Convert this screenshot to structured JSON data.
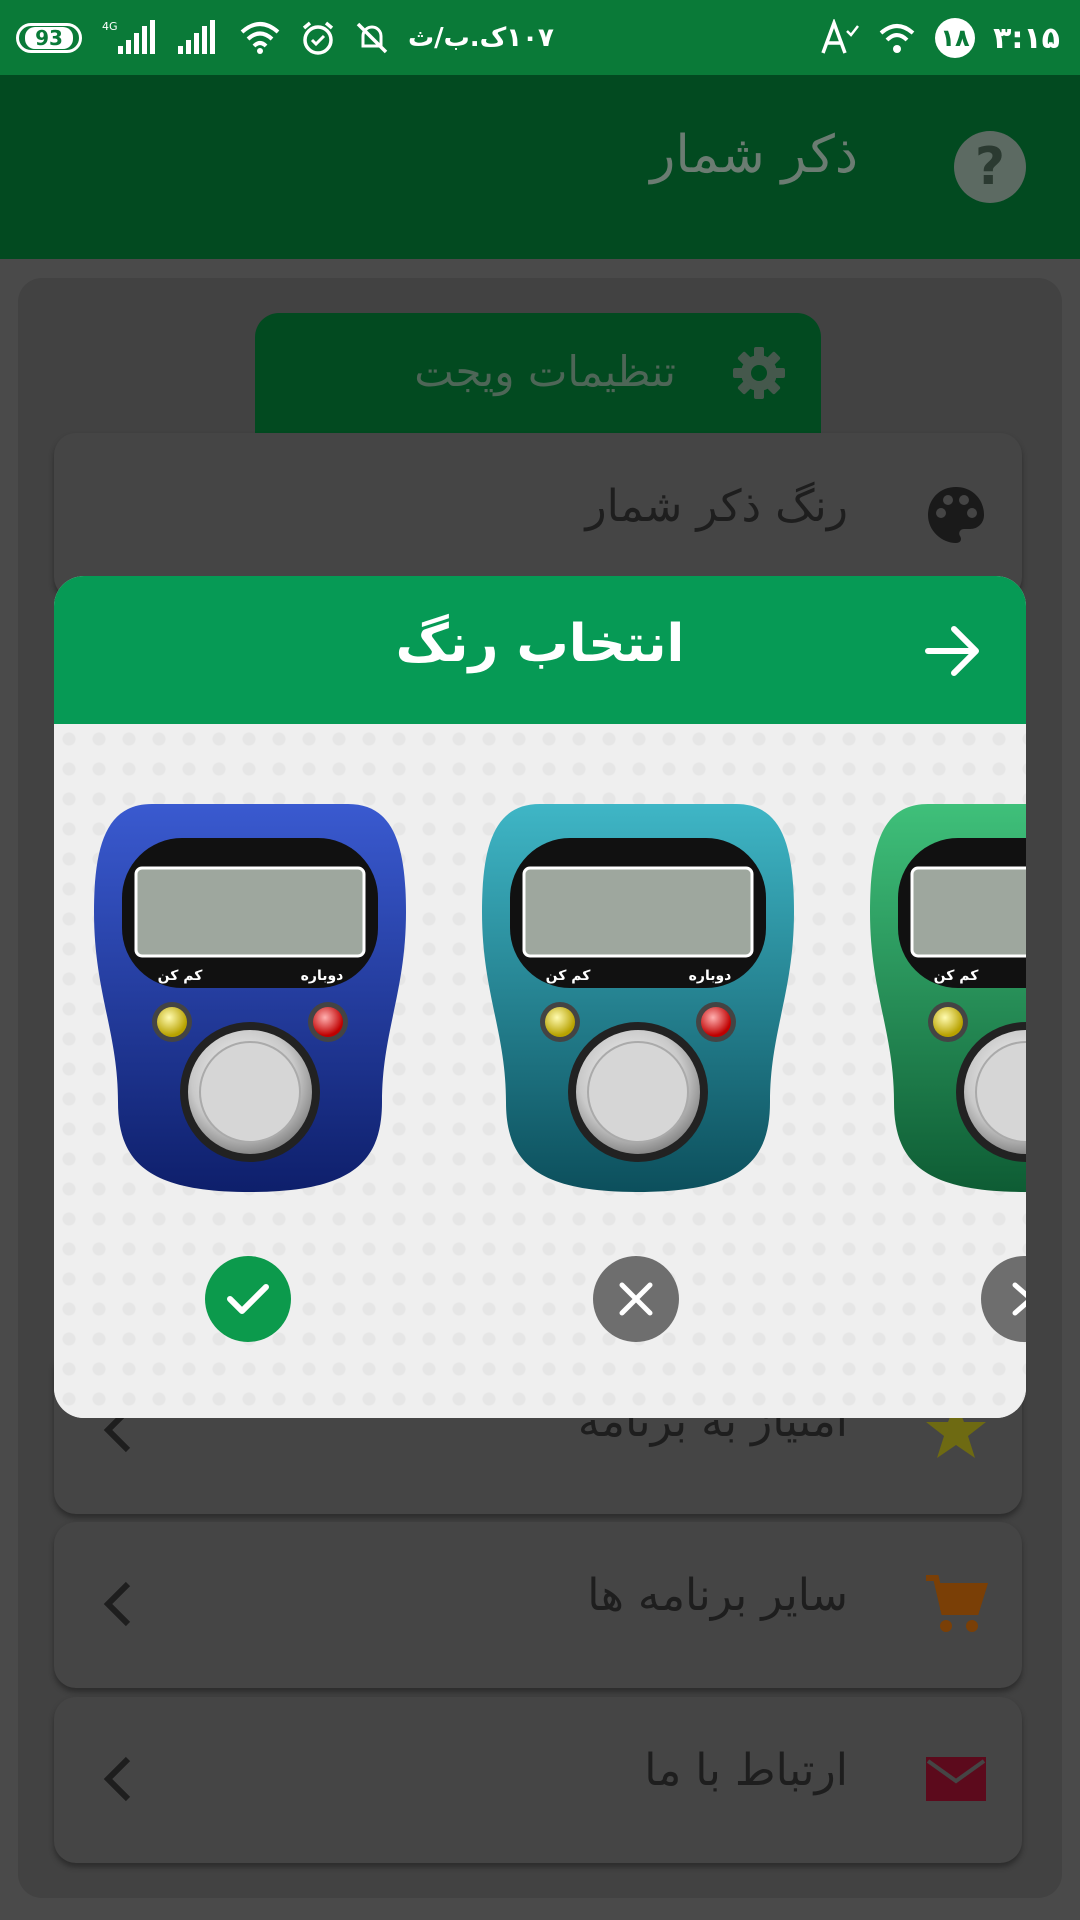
{
  "status_bar": {
    "battery": "93",
    "network_type": "4G",
    "data_rate": "۱۰۷ک.ب/ث",
    "clock": "۳:۱۵",
    "notification_count": "۱۸"
  },
  "app_bar": {
    "title": "ذکر شمار",
    "help_icon": "question-mark-icon"
  },
  "widget_settings": {
    "label": "تنظیمات ویجت",
    "icon": "gear-icon"
  },
  "menu": [
    {
      "label": "رنگ ذکر شمار",
      "icon": "palette-icon"
    },
    {
      "label": "امتیاز به برنامه",
      "icon": "star-icon"
    },
    {
      "label": "سایر برنامه ها",
      "icon": "cart-icon"
    },
    {
      "label": "ارتباط با ما",
      "icon": "mail-icon"
    }
  ],
  "dialog": {
    "title": "انتخاب رنگ",
    "back_icon": "arrow-right-icon",
    "counters": [
      {
        "color": "#1e3a9c",
        "left_label": "کم کن",
        "right_label": "دوباره",
        "state": "selected"
      },
      {
        "color": "#1f8fa0",
        "left_label": "کم کن",
        "right_label": "دوباره",
        "state": "not-selected"
      },
      {
        "color": "#1f9a5a",
        "left_label": "کم کن",
        "right_label": "",
        "state": "next"
      }
    ]
  },
  "colors": {
    "status_bar": "#0a7a38",
    "app_bar": "#024a20",
    "dialog_header": "#069a55",
    "selected_check": "#0c9a4c"
  }
}
